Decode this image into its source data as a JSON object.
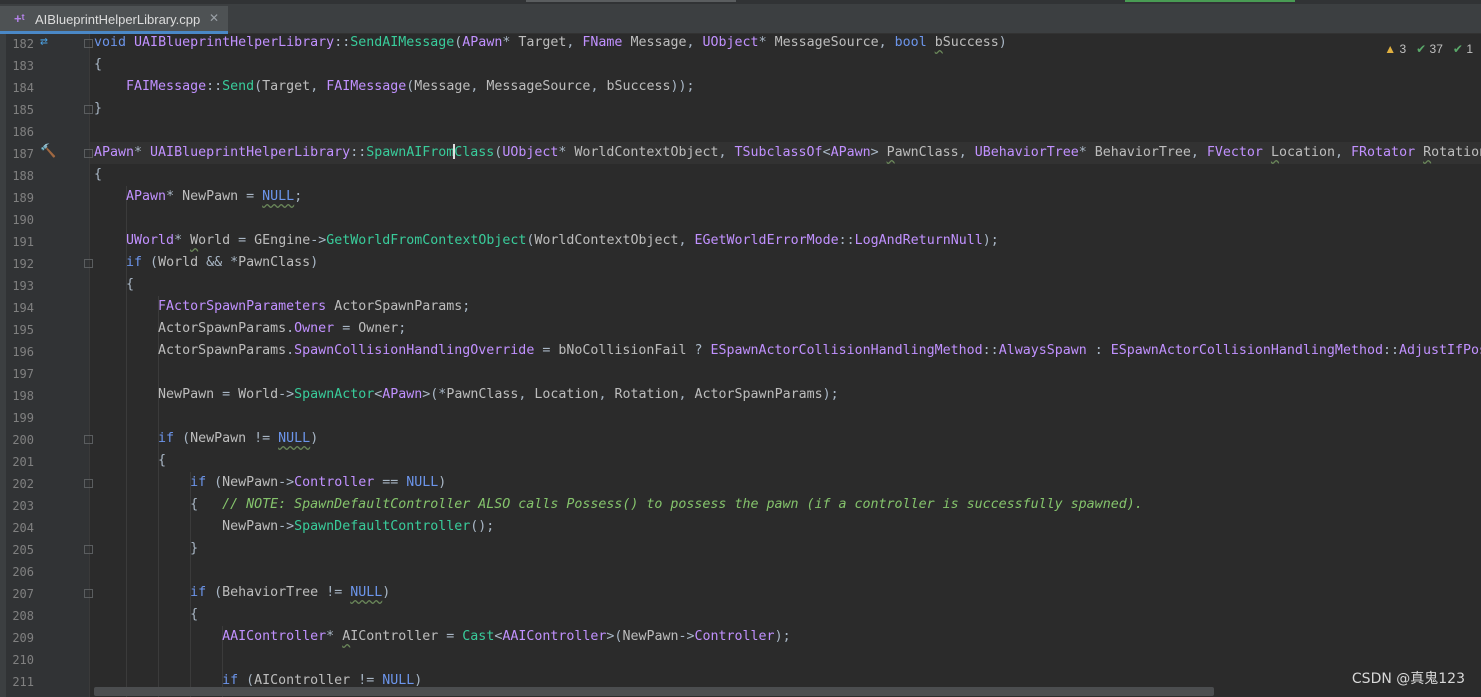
{
  "tab": {
    "icon": "cpp-file-icon",
    "filename": "AIBlueprintHelperLibrary.cpp",
    "close": "✕"
  },
  "inspections": {
    "warnings": "3",
    "weak_warnings": "37",
    "typos": "1"
  },
  "line_numbers": [
    "182",
    "183",
    "184",
    "185",
    "186",
    "187",
    "188",
    "189",
    "190",
    "191",
    "192",
    "193",
    "194",
    "195",
    "196",
    "197",
    "198",
    "199",
    "200",
    "201",
    "202",
    "203",
    "204",
    "205",
    "206",
    "207",
    "208",
    "209",
    "210",
    "211"
  ],
  "watermark": "CSDN @真鬼123",
  "gutter_icons": {
    "line182": "⇄",
    "line187": "🔨"
  }
}
